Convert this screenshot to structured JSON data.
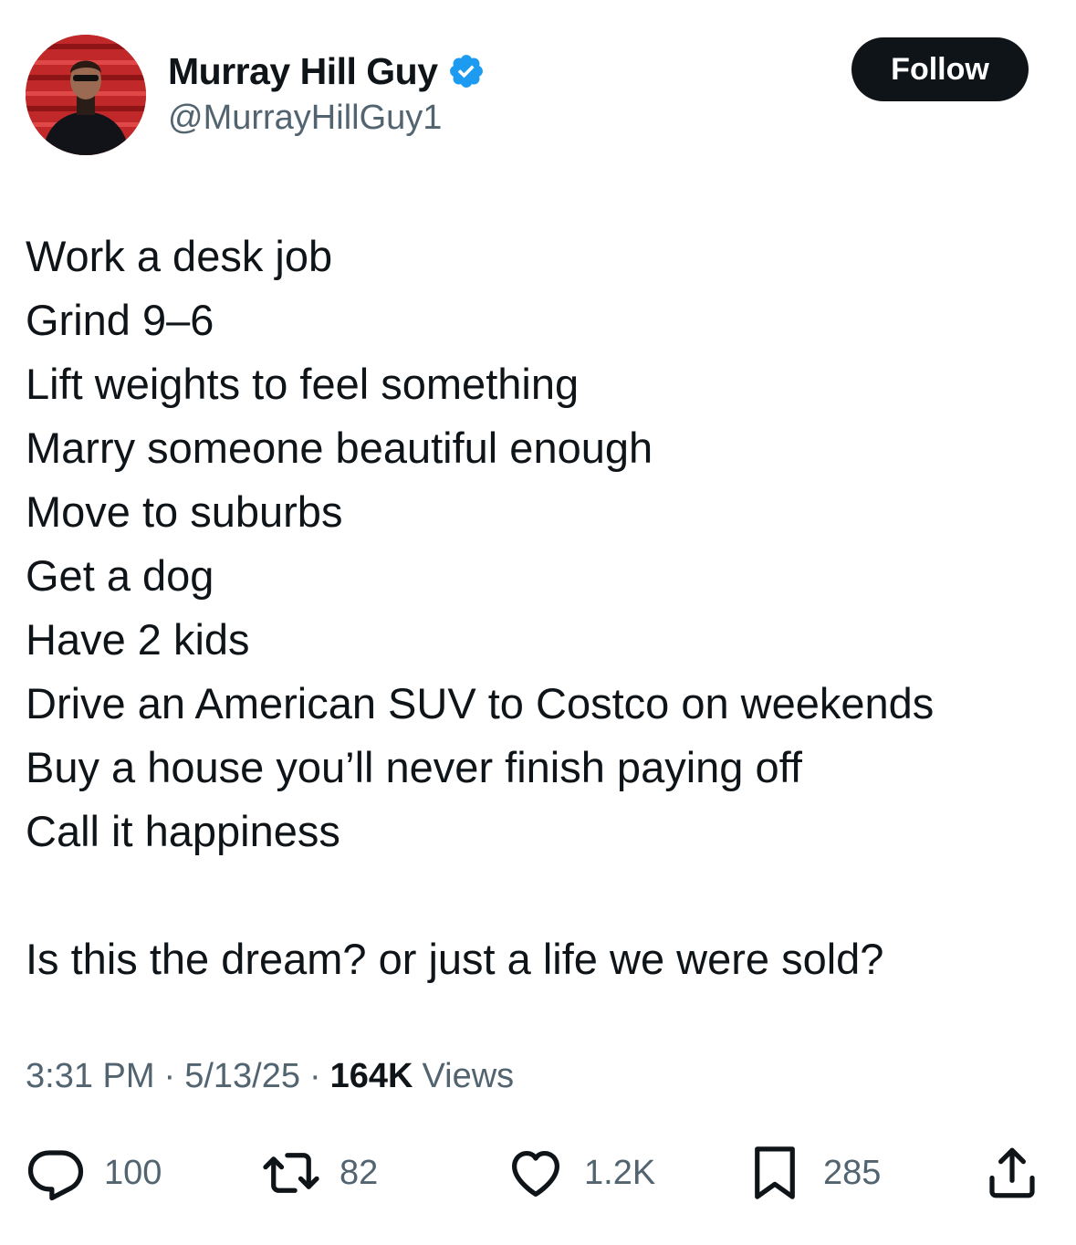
{
  "author": {
    "display_name": "Murray Hill Guy",
    "handle": "@MurrayHillGuy1",
    "verified": true,
    "verified_color": "#1d9bf0"
  },
  "follow_button": {
    "label": "Follow"
  },
  "tweet": {
    "lines": [
      "Work a desk job",
      "Grind 9–6",
      "Lift weights to feel something",
      "Marry someone beautiful enough",
      "Move to suburbs",
      "Get a dog",
      "Have 2 kids",
      "Drive an American SUV to Costco on weekends",
      "Buy a house you’ll never finish paying off",
      "Call it happiness"
    ],
    "closing_line": "Is this the dream? or just a life we were sold?"
  },
  "meta": {
    "time": "3:31 PM",
    "date": "5/13/25",
    "views_count": "164K",
    "views_label": "Views",
    "separator": "·"
  },
  "actions": {
    "replies": {
      "icon": "reply-icon",
      "count": "100"
    },
    "reposts": {
      "icon": "repost-icon",
      "count": "82"
    },
    "likes": {
      "icon": "heart-icon",
      "count": "1.2K"
    },
    "bookmarks": {
      "icon": "bookmark-icon",
      "count": "285"
    },
    "share": {
      "icon": "share-icon"
    }
  },
  "colors": {
    "text_primary": "#0f1419",
    "text_secondary": "#536471",
    "follow_bg": "#0f1419",
    "follow_text": "#ffffff"
  }
}
